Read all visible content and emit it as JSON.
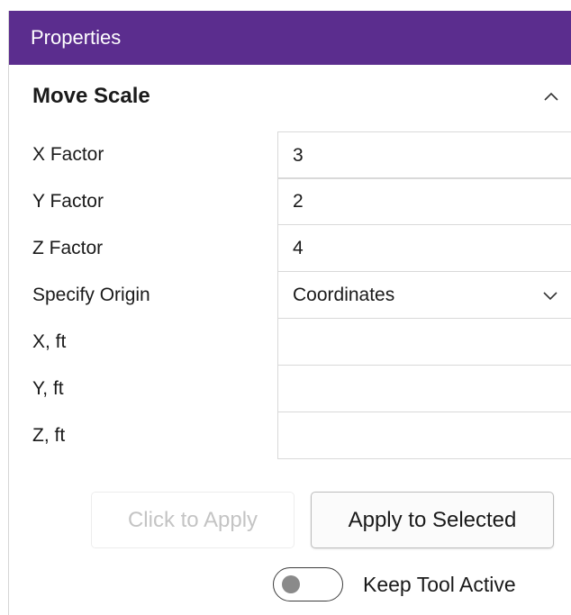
{
  "panel": {
    "title": "Properties"
  },
  "section": {
    "title": "Move Scale",
    "collapsed": false
  },
  "fields": [
    {
      "label": "X Factor",
      "value": "3"
    },
    {
      "label": "Y Factor",
      "value": "2"
    },
    {
      "label": "Z Factor",
      "value": "4"
    },
    {
      "label": "Specify Origin",
      "value": "Coordinates"
    },
    {
      "label": "X, ft",
      "value": ""
    },
    {
      "label": "Y, ft",
      "value": ""
    },
    {
      "label": "Z, ft",
      "value": ""
    }
  ],
  "actions": {
    "click_to_apply": "Click to Apply",
    "apply_to_selected": "Apply to Selected"
  },
  "toggle": {
    "label": "Keep Tool Active",
    "on": false
  },
  "colors": {
    "header_bg": "#5b2d8e",
    "header_text": "#ffffff"
  },
  "icons": {
    "collapse": "chevron-up-icon",
    "dropdown": "chevron-down-icon"
  }
}
